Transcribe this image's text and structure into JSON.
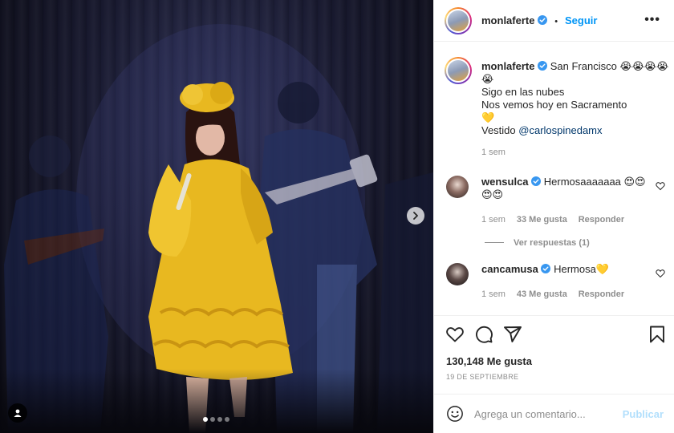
{
  "post": {
    "author": "monlaferte",
    "follow_label": "Seguir",
    "more_label": "•••",
    "separator": "•"
  },
  "caption": {
    "username": "monlaferte",
    "line1": "San Francisco 😭😭😭😭",
    "line2": "😭",
    "line3": "Sigo en las nubes",
    "line4": "Nos vemos hoy en Sacramento",
    "line5": "💛",
    "line6_prefix": "Vestido ",
    "line6_mention": "@carlospinedamx",
    "time": "1 sem"
  },
  "comments": [
    {
      "username": "wensulca",
      "text": "Hermosaaaaaaa 😍😍",
      "text_cont": "😍😍",
      "time": "1 sem",
      "likes": "33 Me gusta",
      "reply": "Responder",
      "view_replies": "Ver respuestas (1)"
    },
    {
      "username": "cancamusa",
      "text": "Hermosa💛",
      "time": "1 sem",
      "likes": "43 Me gusta",
      "reply": "Responder"
    }
  ],
  "engagement": {
    "likes": "130,148 Me gusta",
    "date": "19 de septiembre"
  },
  "comment_box": {
    "placeholder": "Agrega un comentario...",
    "submit": "Publicar"
  },
  "media": {
    "carousel_count": 4,
    "active_index": 0
  },
  "colors": {
    "accent": "#0095f6",
    "verified": "#3897f0",
    "dress": "#e8b820"
  }
}
